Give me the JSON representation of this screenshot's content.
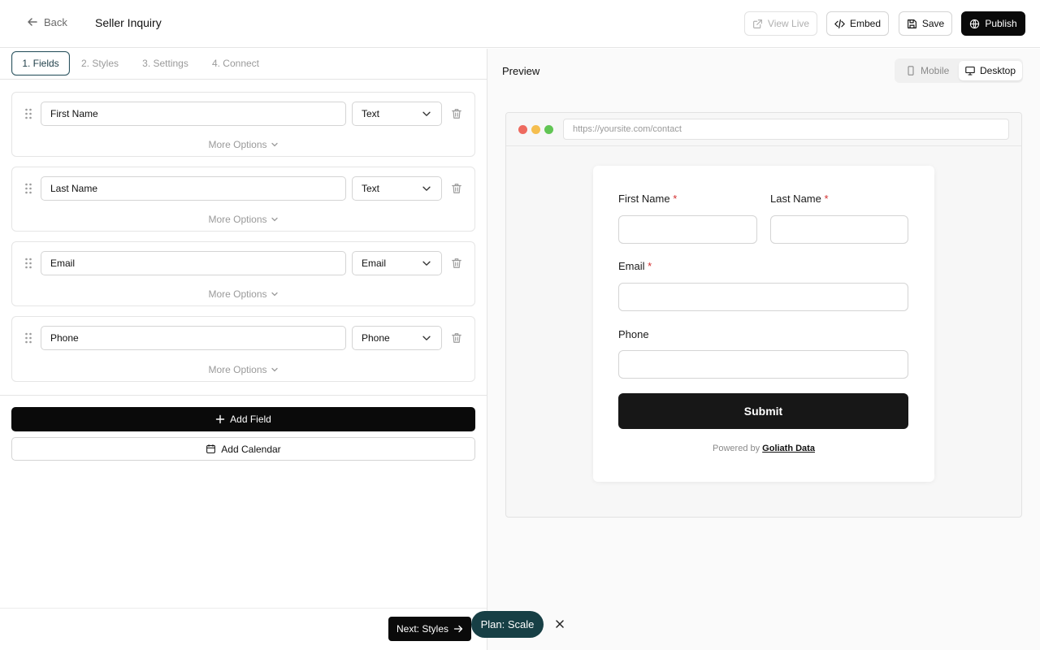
{
  "header": {
    "back_label": "Back",
    "title": "Seller Inquiry",
    "view_live_label": "View Live",
    "embed_label": "Embed",
    "save_label": "Save",
    "publish_label": "Publish"
  },
  "tabs": [
    {
      "label": "1. Fields",
      "active": true
    },
    {
      "label": "2. Styles",
      "active": false
    },
    {
      "label": "3. Settings",
      "active": false
    },
    {
      "label": "4. Connect",
      "active": false
    }
  ],
  "fields": [
    {
      "name": "First Name",
      "type": "Text",
      "more": "More Options"
    },
    {
      "name": "Last Name",
      "type": "Text",
      "more": "More Options"
    },
    {
      "name": "Email",
      "type": "Email",
      "more": "More Options"
    },
    {
      "name": "Phone",
      "type": "Phone",
      "more": "More Options"
    }
  ],
  "actions": {
    "add_field_label": "Add Field",
    "add_calendar_label": "Add Calendar"
  },
  "preview": {
    "label": "Preview",
    "device_mobile": "Mobile",
    "device_desktop": "Desktop",
    "selected_device": "Desktop",
    "url": "https://yoursite.com/contact",
    "form": {
      "first_name_label": "First Name",
      "last_name_label": "Last Name",
      "email_label": "Email",
      "phone_label": "Phone",
      "required_mark": "*",
      "submit_label": "Submit",
      "powered_prefix": "Powered by",
      "powered_brand": "Goliath Data"
    }
  },
  "footer": {
    "next_label": "Next: Styles",
    "plan_label": "Plan: Scale"
  },
  "colors": {
    "primary": "#0a0a0a",
    "plan_pill": "#173f45",
    "required": "#d32f2f",
    "dot_red": "#ee6a5f",
    "dot_yellow": "#f5be4f",
    "dot_green": "#61c554"
  }
}
